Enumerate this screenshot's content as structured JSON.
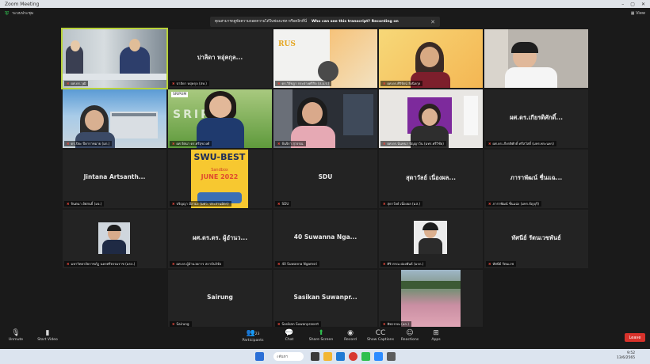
{
  "window": {
    "title": "Zoom Meeting"
  },
  "topbar": {
    "meeting_label": "ระบบประชุม",
    "view_label": "View"
  },
  "banner": {
    "text": "คุณสามารถดูข้อความถอดความได้ในช่องแชท หรือคลิกที่นี่",
    "question": "Who can see this transcript? Recording on"
  },
  "tiles": [
    {
      "id": "t1",
      "type": "video",
      "label": "ผศ.ดร.วุฒิ",
      "active": true
    },
    {
      "id": "t2",
      "type": "name",
      "name": "ปาลิดา หอุ่คกุล...",
      "label": "ปาลิดา หอุ่คกุล (สห.)"
    },
    {
      "id": "t3",
      "type": "video",
      "label": "ดร.วิรัชฎา กระจ่างศรีกิจ (ส.อ.ร.)"
    },
    {
      "id": "t4",
      "type": "video",
      "label": "ผศ.ดร.ศิริรัตน์ ยิ่งนิลกุล"
    },
    {
      "id": "t5",
      "type": "video",
      "label": ""
    },
    {
      "id": "t6",
      "type": "video",
      "label": "ดร.ปิยะ ปีดาราหมาย (มก.)"
    },
    {
      "id": "t7",
      "type": "video",
      "label": "ผศ.รัตนา ดร.ศรีสุขวงศ์"
    },
    {
      "id": "t8",
      "type": "video",
      "label": "จันจิรา สุวรรณ"
    },
    {
      "id": "t9",
      "type": "video",
      "label": "ผศ.ดร.นันทนา ปัญญาวัน (มทร.ศรีวิชัย)"
    },
    {
      "id": "t10",
      "type": "name",
      "name": "ผศ.ดร.เกียรติศักดิ์...",
      "label": "ผศ.ดร.เกียรติศักดิ์ ศรีสวัสดิ์ (มทร.พระนคร)"
    },
    {
      "id": "t11",
      "type": "name",
      "name": "Jintana Artsanth...",
      "label": "จินตนา อัศสนธิ์ (มจ.)"
    },
    {
      "id": "t12",
      "type": "poster",
      "poster_title": "SWU-BEST",
      "poster_sub": "Sandbox",
      "poster_date": "JUNE 2022",
      "label": "ปริญญา มีลามะ (มศว. ประสานมิตร)"
    },
    {
      "id": "t13",
      "type": "name",
      "name": "SDU",
      "label": "SDU"
    },
    {
      "id": "t14",
      "type": "name",
      "name": "สุดาวัลย์ เนื่องผล...",
      "label": "สุดาวัลย์ เนื่องผล (มส.)"
    },
    {
      "id": "t15",
      "type": "name",
      "name": "ภาราพัฒน์ ชื่นแฉ...",
      "label": "ภาราพัฒน์ ชื่นแฉ่ง (มทร.ธัญบุรี)"
    },
    {
      "id": "t16",
      "type": "avatar",
      "label": "มหาวิทยาลัยราชภัฏ นครศรีธรรมราช (มรภ.)"
    },
    {
      "id": "t17",
      "type": "name",
      "name": "ผศ.ดร.ดร. ผู้อำนว...",
      "label": "ผศ.ดร.ผู้อำนวยการ สถาบันวิจัย"
    },
    {
      "id": "t18",
      "type": "name",
      "name": "40 Suwanna Nga...",
      "label": "40 Suwanna Ngamsri"
    },
    {
      "id": "t19",
      "type": "avatar2",
      "label": "ศิริวรรณ ผ่องพันธ์ (มรภ.)"
    },
    {
      "id": "t20",
      "type": "name",
      "name": "ทัศนีย์ รัตนเวชพันธ์",
      "label": "ทัศนีย์ รัตนเวช"
    },
    {
      "id": "t21",
      "type": "name",
      "name": "Sairung",
      "label": "Sairung"
    },
    {
      "id": "t22",
      "type": "name",
      "name": "Sasikan Suwanpr...",
      "label": "Sasikan Suwanprasert"
    },
    {
      "id": "t23",
      "type": "photo",
      "label": "ทิพวรรณ (มก.)"
    }
  ],
  "toolbar": {
    "unmute": "Unmute",
    "start_video": "Start Video",
    "participants": "Participants",
    "participants_count": "23",
    "chat": "Chat",
    "share_screen": "Share Screen",
    "record": "Record",
    "show_captions": "Show Captions",
    "reactions": "Reactions",
    "apps": "Apps",
    "end": "Leave"
  },
  "taskbar": {
    "search": "ค้นหา",
    "time": "9:52",
    "date": "13/6/2565"
  },
  "colors": {
    "active_border": "#b8d23a",
    "share_green": "#2fbf4f",
    "end_red": "#d7322b"
  }
}
